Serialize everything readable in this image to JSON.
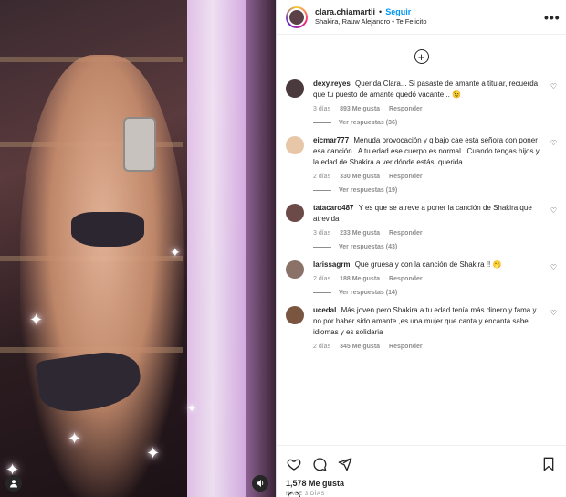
{
  "header": {
    "username": "clara.chiamartii",
    "dot": "•",
    "follow_label": "Seguir",
    "song": "Shakira, Rauw Alejandro • Te Felicito",
    "more_glyph": "•••"
  },
  "add_glyph": "+",
  "comments": [
    {
      "user": "dexy.reyes",
      "text": "Querida Clara... Si pasaste de amante a titular, recuerda que tu puesto de amante quedó vacante... 😉",
      "time": "3 días",
      "likes": "893 Me gusta",
      "reply": "Responder",
      "view_replies": "Ver respuestas (36)",
      "avatar_color": "#4a3a3e"
    },
    {
      "user": "eicmar777",
      "text": "Menuda provocación y q bajo cae esta señora con poner esa canción . A tu edad ese cuerpo es normal . Cuando tengas hijos y la edad de Shakira a ver dónde estás. querida.",
      "time": "2 días",
      "likes": "330 Me gusta",
      "reply": "Responder",
      "view_replies": "Ver respuestas (19)",
      "avatar_color": "#e7c7a8"
    },
    {
      "user": "tatacaro487",
      "text": "Y es que se atreve a poner la canción de Shakira que atrevida",
      "time": "3 días",
      "likes": "233 Me gusta",
      "reply": "Responder",
      "view_replies": "Ver respuestas (43)",
      "avatar_color": "#6b4a48"
    },
    {
      "user": "larissagrm",
      "text": "Que gruesa y con la canción de Shakira !! 🫢",
      "time": "2 días",
      "likes": "188 Me gusta",
      "reply": "Responder",
      "view_replies": "Ver respuestas (14)",
      "avatar_color": "#8a7268"
    },
    {
      "user": "ucedal",
      "text": "Más joven pero Shakira a tu edad tenía más dinero y fama y no por haber sido amante ,es una mujer que canta y encanta sabe idiomas y es solidaria",
      "time": "2 días",
      "likes": "345 Me gusta",
      "reply": "Responder",
      "view_replies": "",
      "avatar_color": "#7a5540"
    }
  ],
  "actions": {
    "heart_icon": "heart-icon",
    "comment_icon": "comment-icon",
    "share_icon": "share-icon",
    "save_icon": "bookmark-icon",
    "likes": "1,578 Me gusta",
    "posted": "HACE 3 DÍAS"
  },
  "media": {
    "user_icon": "user-tag-icon",
    "audio_icon": "speaker-icon"
  }
}
